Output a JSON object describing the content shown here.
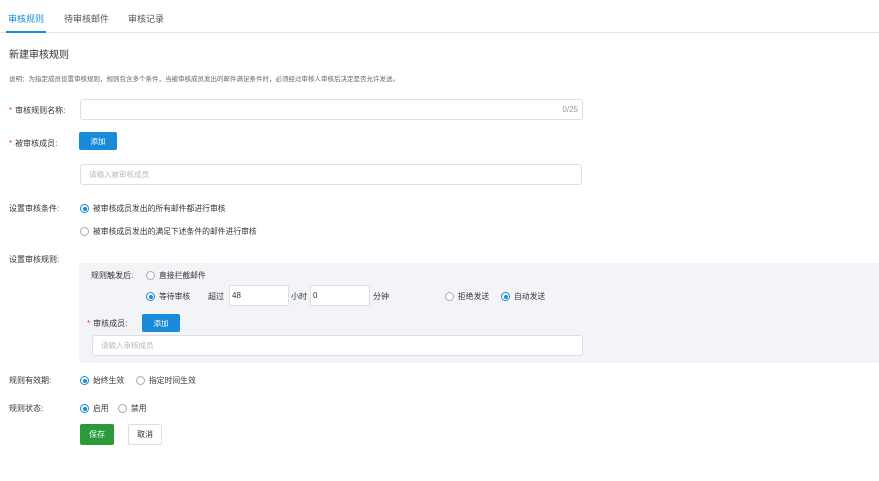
{
  "tabs": [
    {
      "label": "审核规则"
    },
    {
      "label": "待审核邮件"
    },
    {
      "label": "审核记录"
    }
  ],
  "form": {
    "title": "新建审核规则",
    "description": "说明：为指定成员设置审核规则，规则包含多个条件，当被审核成员发出的邮件满足条件时，必须经过审核人审核后决定是否允许发送。",
    "rule_name": {
      "label": "审核规则名称:",
      "value": "",
      "counter": "0/25"
    },
    "members": {
      "label": "被审核成员:",
      "add_label": "添加",
      "placeholder": "请输入被审核成员"
    },
    "condition": {
      "label": "设置审核条件:",
      "options": [
        "被审核成员发出的所有邮件都进行审核",
        "被审核成员发出的满足下述条件的邮件进行审核"
      ],
      "selected": 0
    },
    "rule": {
      "label": "设置审核规则:",
      "trigger_label": "规则触发后:",
      "block_label": "直接拦截邮件",
      "wait_label": "等待审核",
      "exceed_label": "超过",
      "hours_value": "48",
      "hours_unit": "小时",
      "minutes_value": "0",
      "minutes_unit": "分钟",
      "reject_label": "拒绝发送",
      "auto_label": "自动发送",
      "trigger_selected": "wait",
      "timeout_selected": "auto",
      "reviewers_label": "审核成员:",
      "reviewers_add_label": "添加",
      "reviewers_placeholder": "请输入审核成员"
    },
    "validity": {
      "label": "规则有效期:",
      "options": [
        "始终生效",
        "指定时间生效"
      ],
      "selected": 0
    },
    "status": {
      "label": "规则状态:",
      "options": [
        "启用",
        "禁用"
      ],
      "selected": 0
    },
    "save_label": "保存",
    "cancel_label": "取消"
  },
  "colors": {
    "accent": "#1a8bd8",
    "save": "#2a9a3a",
    "required": "#e53935",
    "panel": "#f2f4f7"
  }
}
